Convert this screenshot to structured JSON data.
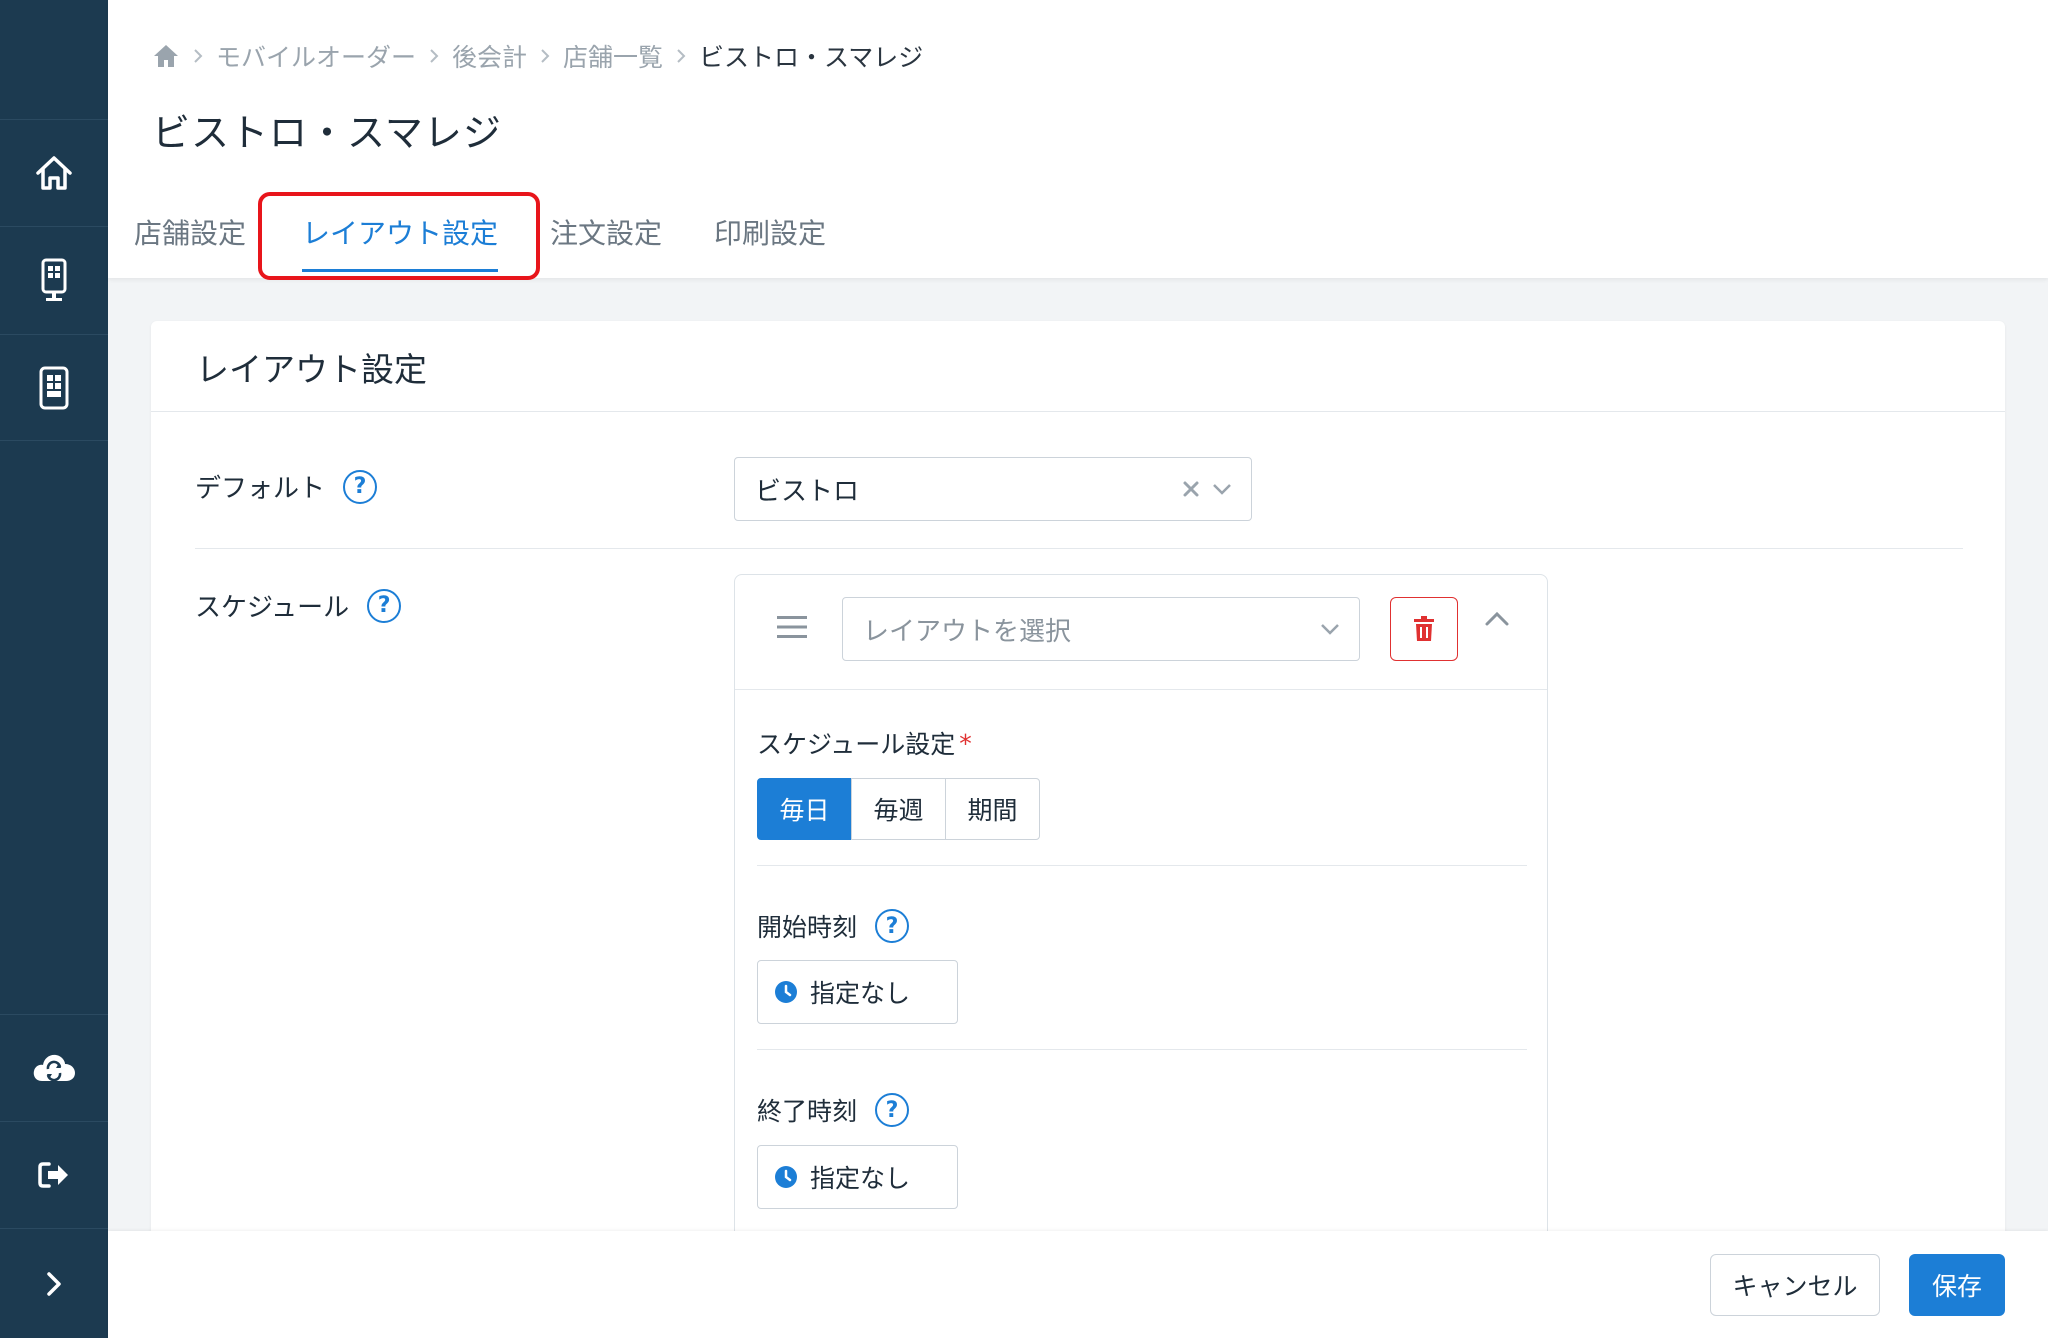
{
  "breadcrumb": {
    "home_icon": "home-icon",
    "items": [
      "モバイルオーダー",
      "後会計",
      "店舗一覧"
    ],
    "current": "ビストロ・スマレジ"
  },
  "page_title": "ビストロ・スマレジ",
  "tabs": [
    {
      "label": "店舗設定",
      "active": false
    },
    {
      "label": "レイアウト設定",
      "active": true
    },
    {
      "label": "注文設定",
      "active": false
    },
    {
      "label": "印刷設定",
      "active": false
    }
  ],
  "sidebar": {
    "items": [
      "home-icon",
      "kiosk-icon",
      "tablet-icon",
      "cloud-sync-icon",
      "logout-icon",
      "expand-icon"
    ]
  },
  "card": {
    "title": "レイアウト設定",
    "default": {
      "label": "デフォルト",
      "help": "?",
      "value": "ビストロ"
    },
    "schedule": {
      "label": "スケジュール",
      "help": "?",
      "layout_placeholder": "レイアウトを選択",
      "schedule_setting_label": "スケジュール設定",
      "required_mark": "*",
      "options": [
        "毎日",
        "毎週",
        "期間"
      ],
      "selected": "毎日",
      "start_label": "開始時刻",
      "start_value": "指定なし",
      "end_label": "終了時刻",
      "end_value": "指定なし"
    }
  },
  "footer": {
    "cancel_label": "キャンセル",
    "save_label": "保存"
  },
  "colors": {
    "sidebar": "#1c3a50",
    "accent": "#1c7ed6",
    "danger": "#e03131",
    "highlight": "#e8151b"
  }
}
